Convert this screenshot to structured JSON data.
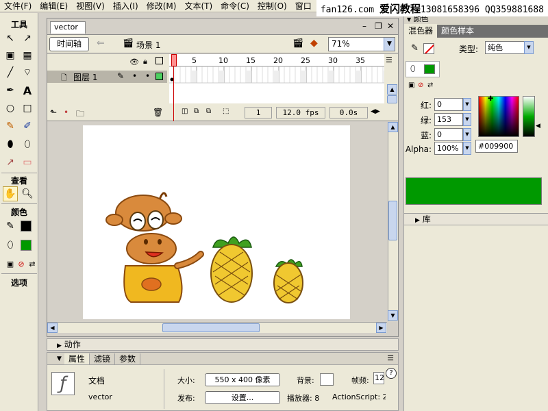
{
  "menu": [
    "文件(F)",
    "编辑(E)",
    "视图(V)",
    "插入(I)",
    "修改(M)",
    "文本(T)",
    "命令(C)",
    "控制(O)",
    "窗口"
  ],
  "banner": {
    "site": "fan126.com",
    "brand": "爱闪教程",
    "contact": "13081658396 QQ359881688"
  },
  "toolbar": {
    "tools_title": "工具",
    "view_title": "查看",
    "colors_title": "颜色",
    "options_title": "选项"
  },
  "colors": {
    "fill": "#009900",
    "stroke": "#000000"
  },
  "document": {
    "tab": "vector",
    "timeline_button": "时间轴",
    "scene": "场景 1",
    "zoom": "71%"
  },
  "timeline": {
    "layer_name": "图层 1",
    "frame_numbers": [
      "1",
      "5",
      "10",
      "15",
      "20",
      "25",
      "30",
      "35"
    ],
    "current_frame": "1",
    "fps": "12.0 fps",
    "time": "0.0s"
  },
  "panels": {
    "actions_label": "动作",
    "props_tabs": [
      "属性",
      "滤镜",
      "参数"
    ],
    "doc_label": "文档",
    "doc_name": "vector",
    "size_label": "大小:",
    "size_value": "550 x 400 像素",
    "publish_label": "发布:",
    "settings_button": "设置...",
    "bg_label": "背景:",
    "player_label": "播放器: 8",
    "as_label": "ActionScript: 2",
    "fps_label": "帧频:",
    "fps_value": "12",
    "help": "?"
  },
  "mixer": {
    "panel_title": "颜色",
    "tabs": [
      "混色器",
      "颜色样本"
    ],
    "type_label": "类型:",
    "type_value": "纯色",
    "red_label": "红:",
    "red": "0",
    "green_label": "绿:",
    "green": "153",
    "blue_label": "蓝:",
    "blue": "0",
    "alpha_label": "Alpha:",
    "alpha": "100%",
    "hex": "#009900",
    "library_label": "库"
  }
}
